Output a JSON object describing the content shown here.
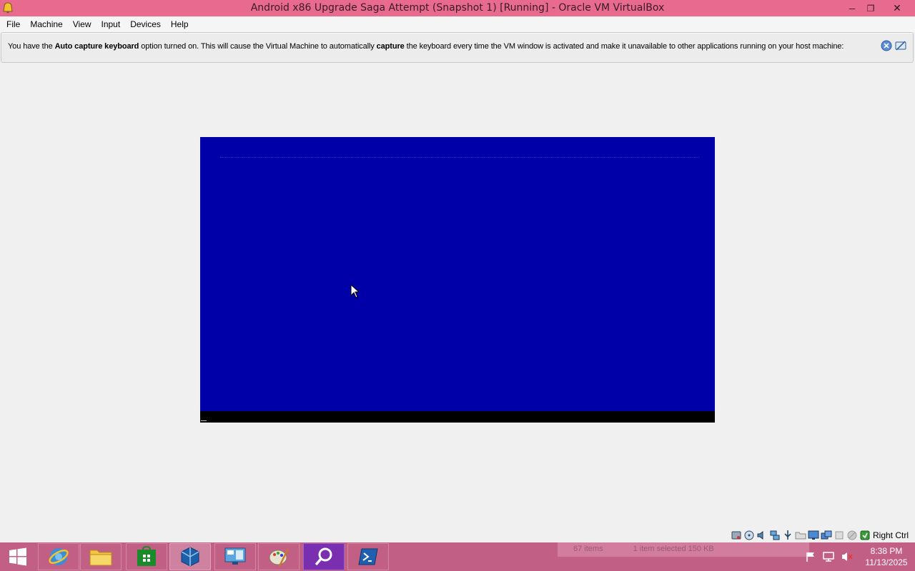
{
  "window": {
    "title": "Android x86 Upgrade Saga Attempt (Snapshot 1) [Running] - Oracle VM VirtualBox",
    "app_icon": "virtualbox-window-icon",
    "buttons": {
      "minimize": "─",
      "maximize": "❐",
      "close": "✕"
    }
  },
  "menu": [
    "File",
    "Machine",
    "View",
    "Input",
    "Devices",
    "Help"
  ],
  "notice": {
    "part1": "You have the ",
    "bold1": "Auto capture keyboard",
    "part2": " option turned on. This will cause the Virtual Machine to automatically ",
    "bold2": "capture",
    "part3": " the keyboard every time the VM window is activated and make it unavailable to other applications running on your host machine:",
    "buttons": [
      "info-icon",
      "close-notice-icon"
    ]
  },
  "vm": {
    "screen_color": "#0000a8",
    "console_color": "#000000"
  },
  "statusbar": {
    "icons": [
      "hard-disk-icon",
      "optical-drive-icon",
      "audio-icon",
      "network-icon",
      "usb-icon",
      "shared-folders-icon",
      "display-icon",
      "video-capture-icon",
      "cpu-icon",
      "mouse-integration-icon",
      "keyboard-capture-icon"
    ],
    "host_key": "Right Ctrl"
  },
  "taskbar": {
    "apps": [
      "internet-explorer-icon",
      "file-explorer-icon",
      "store-icon",
      "virtualbox-icon",
      "remote-desktop-icon",
      "paint-icon",
      "search-icon",
      "powershell-icon"
    ],
    "peek": {
      "items": "67 items",
      "selected": "1 item selected  150 KB"
    },
    "clock": {
      "time": "8:38 PM",
      "date": "11/13/2025"
    }
  },
  "colors": {
    "titlebar": "#e86b8f",
    "taskbar": "#c25f84",
    "vm_blue": "#0000a8"
  }
}
